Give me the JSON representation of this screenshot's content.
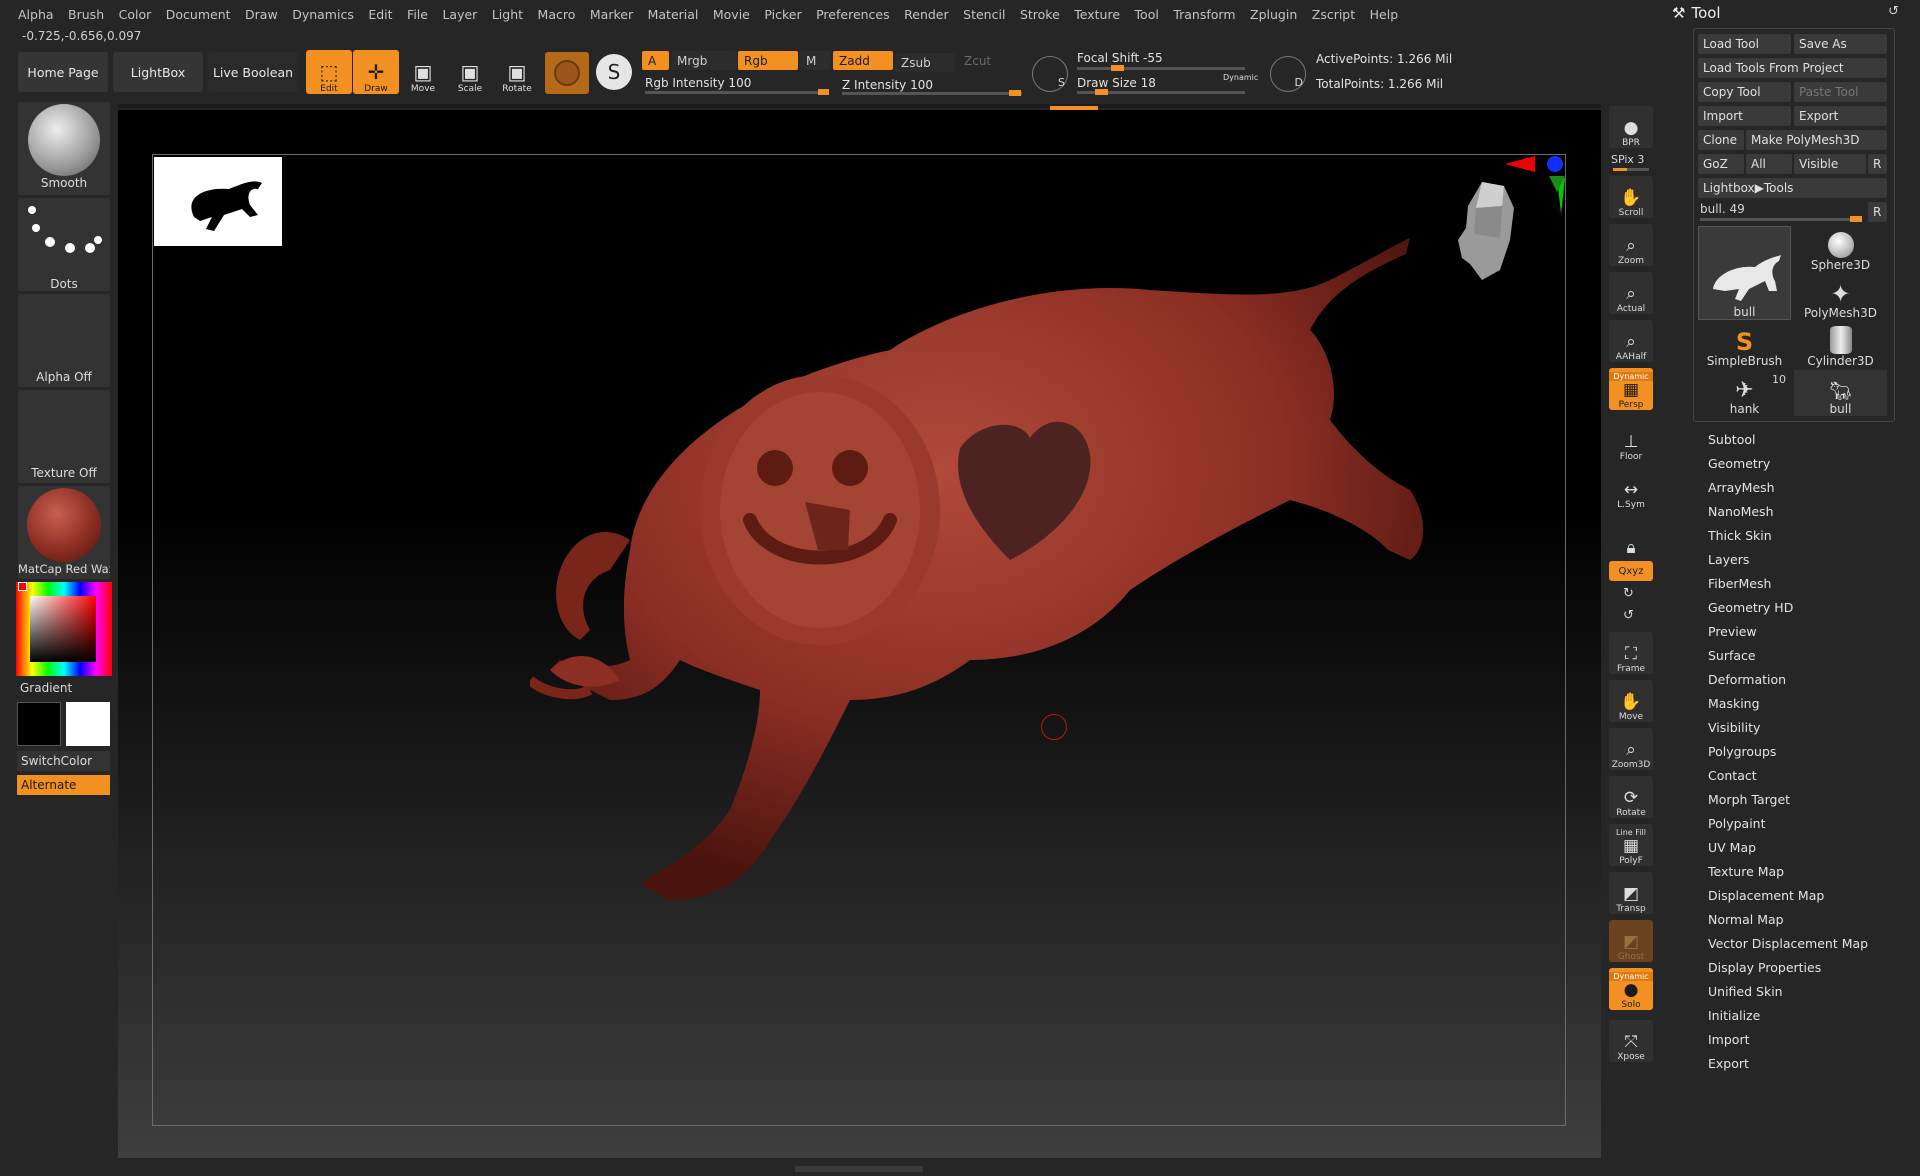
{
  "menu": [
    "Alpha",
    "Brush",
    "Color",
    "Document",
    "Draw",
    "Dynamics",
    "Edit",
    "File",
    "Layer",
    "Light",
    "Macro",
    "Marker",
    "Material",
    "Movie",
    "Picker",
    "Preferences",
    "Render",
    "Stencil",
    "Stroke",
    "Texture",
    "Tool",
    "Transform",
    "Zplugin",
    "Zscript",
    "Help"
  ],
  "coords": "-0.725,-0.656,0.097",
  "shelf": {
    "home": "Home Page",
    "lightbox": "LightBox",
    "live_boolean": "Live Boolean",
    "edit": "Edit",
    "draw": "Draw",
    "move": "Move",
    "scale": "Scale",
    "rotate": "Rotate",
    "a": "A",
    "mrgb": "Mrgb",
    "rgb": "Rgb",
    "m": "M",
    "zadd": "Zadd",
    "zsub": "Zsub",
    "zcut": "Zcut",
    "rgb_intensity": "Rgb Intensity 100",
    "z_intensity": "Z Intensity 100",
    "focal_shift": "Focal Shift -55",
    "draw_size": "Draw Size 18",
    "dynamic": "Dynamic",
    "s": "S",
    "d": "D",
    "active_points": "ActivePoints: 1.266 Mil",
    "total_points": "TotalPoints: 1.266 Mil"
  },
  "left": {
    "smooth": "Smooth",
    "dots": "Dots",
    "alpha_off": "Alpha Off",
    "texture_off": "Texture Off",
    "matcap": "MatCap Red Wax",
    "gradient": "Gradient",
    "switchcolor": "SwitchColor",
    "alternate": "Alternate"
  },
  "right_shelf": {
    "bpr": "BPR",
    "spix": "SPix 3",
    "scroll": "Scroll",
    "zoom": "Zoom",
    "actual": "Actual",
    "aahalf": "AAHalf",
    "dynamic": "Dynamic",
    "persp": "Persp",
    "floor": "Floor",
    "lsym": "L.Sym",
    "xyz": "Qxyz",
    "frame": "Frame",
    "move": "Move",
    "zoom3d": "Zoom3D",
    "rotate": "Rotate",
    "linefill": "Line Fill",
    "polyf": "PolyF",
    "transp": "Transp",
    "ghost": "Ghost",
    "solo": "Solo",
    "xpose": "Xpose"
  },
  "tool": {
    "title": "Tool",
    "buttons": {
      "load_tool": "Load Tool",
      "save_as": "Save As",
      "load_from_project": "Load Tools From Project",
      "copy_tool": "Copy Tool",
      "paste_tool": "Paste Tool",
      "import": "Import",
      "export": "Export",
      "clone": "Clone",
      "make_polymesh": "Make PolyMesh3D",
      "goz": "GoZ",
      "all": "All",
      "visible": "Visible",
      "r": "R",
      "lightbox_tools": "Lightbox▶Tools"
    },
    "current": "bull. 49",
    "thumbs": [
      "bull",
      "Sphere3D",
      "PolyMesh3D",
      "SimpleBrush",
      "Cylinder3D",
      "hank",
      "bull"
    ],
    "hank_count": "10",
    "sections": [
      "Subtool",
      "Geometry",
      "ArrayMesh",
      "NanoMesh",
      "Thick Skin",
      "Layers",
      "FiberMesh",
      "Geometry HD",
      "Preview",
      "Surface",
      "Deformation",
      "Masking",
      "Visibility",
      "Polygroups",
      "Contact",
      "Morph Target",
      "Polypaint",
      "UV Map",
      "Texture Map",
      "Displacement Map",
      "Normal Map",
      "Vector Displacement Map",
      "Display Properties",
      "Unified Skin",
      "Initialize",
      "Import",
      "Export"
    ]
  },
  "colors": {
    "accent": "#f29122",
    "wax": "#8c2e24"
  }
}
